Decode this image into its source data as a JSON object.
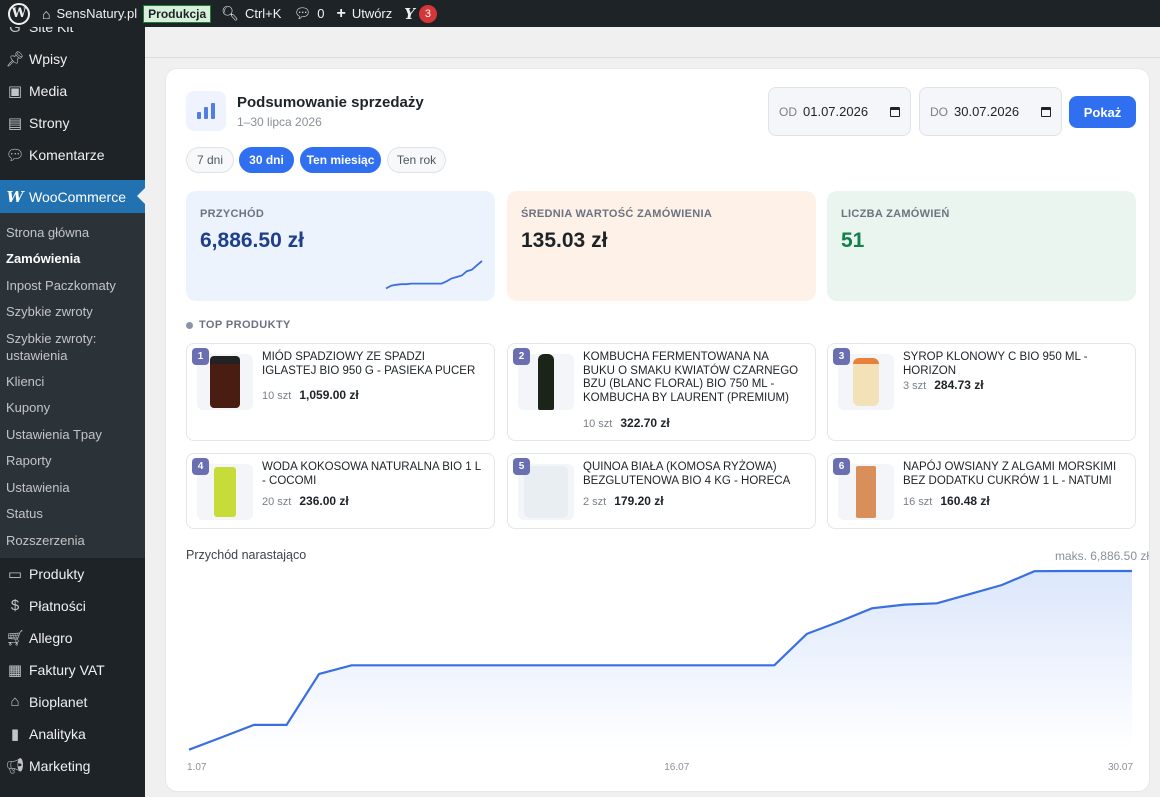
{
  "adminbar": {
    "site_name": "SensNatury.pl",
    "env_badge": "Produkcja",
    "search_shortcut": "Ctrl+K",
    "comments_count": "0",
    "create_label": "Utwórz",
    "seo_badge_count": "3"
  },
  "sidebar": {
    "items_top": [
      {
        "label": "Site Kit",
        "icon": "sitekit-icon"
      },
      {
        "label": "Wpisy",
        "icon": "pin-icon"
      },
      {
        "label": "Media",
        "icon": "media-icon"
      },
      {
        "label": "Strony",
        "icon": "pages-icon"
      },
      {
        "label": "Komentarze",
        "icon": "comment-icon"
      }
    ],
    "active": {
      "label": "WooCommerce",
      "icon": "woo-icon"
    },
    "submenu": [
      "Strona główna",
      "Zamówienia",
      "Inpost Paczkomaty",
      "Szybkie zwroty",
      "Szybkie zwroty: ustawienia",
      "Klienci",
      "Kupony",
      "Ustawienia Tpay",
      "Raporty",
      "Ustawienia",
      "Status",
      "Rozszerzenia"
    ],
    "current_sub": "Zamówienia",
    "items_bottom": [
      {
        "label": "Produkty",
        "icon": "products-icon"
      },
      {
        "label": "Płatności",
        "icon": "payments-icon"
      },
      {
        "label": "Allegro",
        "icon": "cart-icon"
      },
      {
        "label": "Faktury VAT",
        "icon": "invoice-icon"
      },
      {
        "label": "Bioplanet",
        "icon": "store-icon"
      },
      {
        "label": "Analityka",
        "icon": "analytics-icon"
      },
      {
        "label": "Marketing",
        "icon": "megaphone-icon"
      }
    ]
  },
  "header": {
    "title": "Podsumowanie sprzedaży",
    "subtitle": "1–30 lipca 2026"
  },
  "filters": {
    "from_label": "OD",
    "from_value": "01.07.2026",
    "to_label": "DO",
    "to_value": "30.07.2026",
    "show_button": "Pokaż",
    "ranges": [
      "7 dni",
      "30 dni",
      "Ten miesiąc",
      "Ten rok"
    ],
    "active_ranges": [
      "30 dni",
      "Ten miesiąc"
    ]
  },
  "kpis": [
    {
      "label": "PRZYCHÓD",
      "value": "6,886.50 zł",
      "bg": "#edf3fd",
      "color": "#1e3f8a"
    },
    {
      "label": "ŚREDNIA WARTOŚĆ ZAMÓWIENIA",
      "value": "135.03 zł",
      "bg": "#fdf1e8",
      "color": "#1d2327"
    },
    {
      "label": "LICZBA ZAMÓWIEŃ",
      "value": "51",
      "bg": "#e9f5ee",
      "color": "#13804a"
    }
  ],
  "top_products": {
    "label": "TOP PRODUKTY",
    "items": [
      {
        "rank": "1",
        "name": "MIÓD SPADZIOWY ZE SPADZI IGLASTEJ BIO 950 g - PASIEKA PUCER",
        "qty": "10 szt",
        "amount": "1,059.00 zł"
      },
      {
        "rank": "2",
        "name": "KOMBUCHA FERMENTOWANA NA BUKU O SMAKU KWIATÓW CZARNEGO BZU (BLANC FLORAL) BIO 750 ml - KOMBUCHA BY LAURENT (PREMIUM)",
        "qty": "10 szt",
        "amount": "322.70 zł"
      },
      {
        "rank": "3",
        "name": "SYROP KLONOWY C BIO 950 ml - HORIZON",
        "qty": "3 szt",
        "amount": "284.73 zł"
      },
      {
        "rank": "4",
        "name": "WODA KOKOSOWA NATURALNA BIO 1 L - COCOMI",
        "qty": "20 szt",
        "amount": "236.00 zł"
      },
      {
        "rank": "5",
        "name": "QUINOA BIAŁA (KOMOSA RYŻOWA) BEZGLUTENOWA BIO 4 kg - HORECA",
        "qty": "2 szt",
        "amount": "179.20 zł"
      },
      {
        "rank": "6",
        "name": "NAPÓJ OWSIANY Z ALGAMI MORSKIMI BEZ DODATKU CUKRÓW 1 L - NATUMI",
        "qty": "16 szt",
        "amount": "160.48 zł"
      }
    ]
  },
  "chart_data": {
    "type": "area",
    "title": "Przychód narastająco",
    "max_label": "maks. 6,886.50 zł",
    "x_tick_labels": [
      "1.07",
      "16.07",
      "30.07"
    ],
    "x": [
      "1.07",
      "2.07",
      "3.07",
      "4.07",
      "5.07",
      "6.07",
      "7.07",
      "8.07",
      "9.07",
      "10.07",
      "11.07",
      "12.07",
      "13.07",
      "14.07",
      "15.07",
      "16.07",
      "17.07",
      "18.07",
      "19.07",
      "20.07",
      "21.07",
      "22.07",
      "23.07",
      "24.07",
      "25.07",
      "26.07",
      "27.07",
      "28.07",
      "29.07",
      "30.07"
    ],
    "values": [
      50,
      520,
      1000,
      1000,
      2950,
      3280,
      3280,
      3280,
      3280,
      3280,
      3280,
      3280,
      3280,
      3280,
      3280,
      3280,
      3280,
      3280,
      3280,
      4480,
      4950,
      5460,
      5600,
      5650,
      6000,
      6350,
      6880,
      6886.5,
      6886.5,
      6886.5
    ],
    "ylim": [
      0,
      6886.5
    ],
    "line_color": "#3a6fe0",
    "fill_color": "#dce7fb"
  },
  "revenue_sparkline": [
    0.05,
    0.15,
    0.18,
    0.2,
    0.2,
    0.22,
    0.22,
    0.22,
    0.22,
    0.22,
    0.22,
    0.22,
    0.3,
    0.4,
    0.45,
    0.5,
    0.65,
    0.7,
    0.85,
    1.0
  ]
}
